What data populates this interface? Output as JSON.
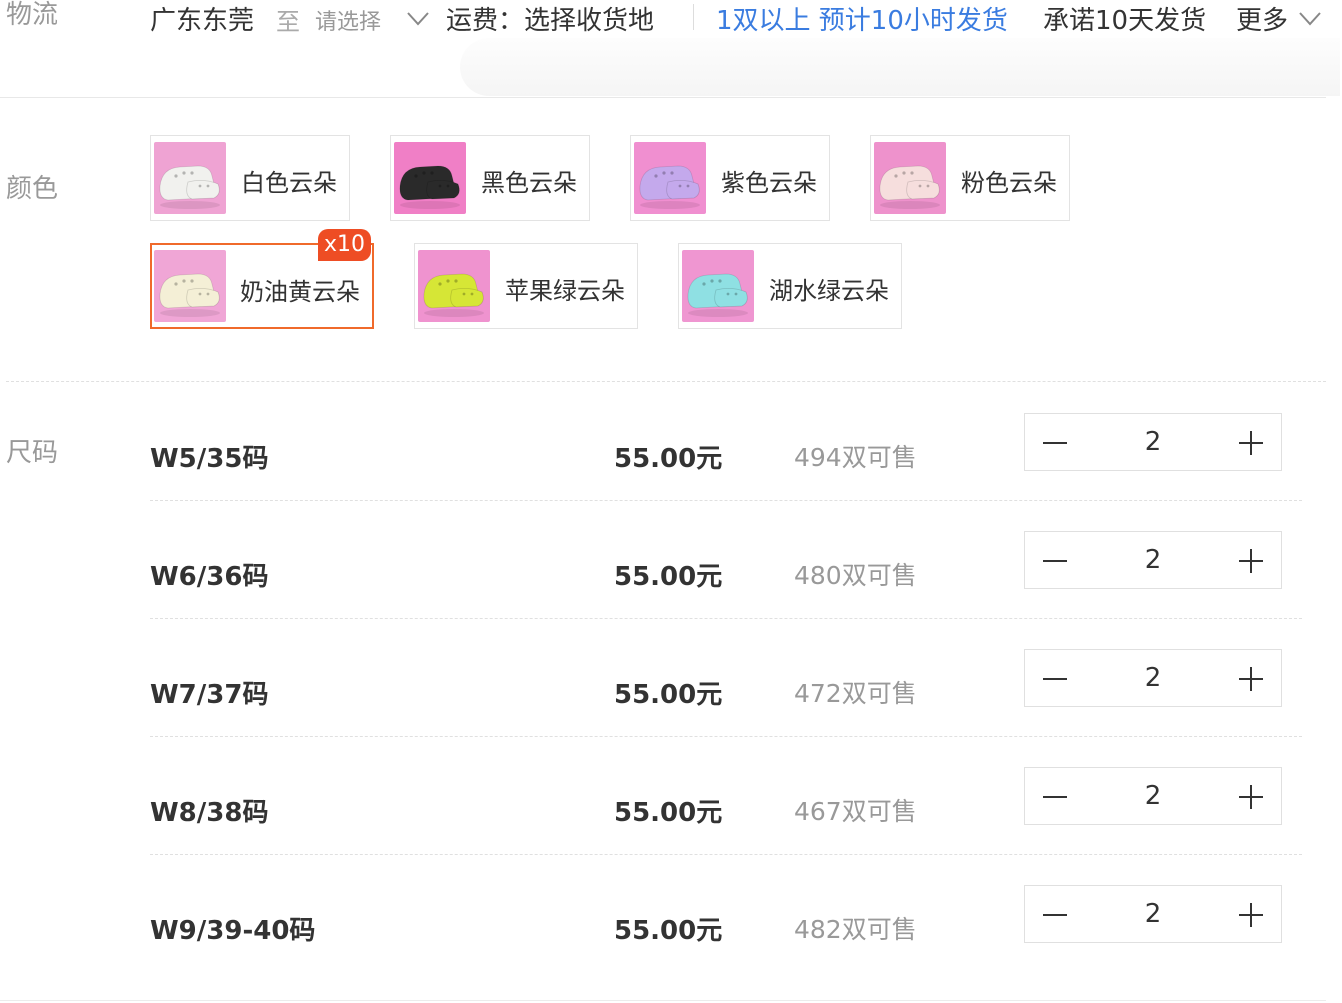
{
  "logistics": {
    "label": "物流",
    "from": "广东东莞",
    "to": "至",
    "select_placeholder": "请选择",
    "fee": "运费：选择收货地",
    "note": "1双以上 预计10小时发货",
    "promise": "承诺10天发货",
    "more": "更多"
  },
  "colors": {
    "label": "颜色",
    "items": [
      {
        "name": "白色云朵",
        "shoe_color": "#f1f1ee",
        "bg": "#efa3d3"
      },
      {
        "name": "黑色云朵",
        "shoe_color": "#2a2a2a",
        "bg": "#f07fc6"
      },
      {
        "name": "紫色云朵",
        "shoe_color": "#c4a9ec",
        "bg": "#f08fd0"
      },
      {
        "name": "粉色云朵",
        "shoe_color": "#f6dedd",
        "bg": "#ee92cc"
      },
      {
        "name": "奶油黄云朵",
        "shoe_color": "#f4efd6",
        "bg": "#f0a6d6",
        "selected": true,
        "badge": "x10"
      },
      {
        "name": "苹果绿云朵",
        "shoe_color": "#d6e636",
        "bg": "#ef93cf"
      },
      {
        "name": "湖水绿云朵",
        "shoe_color": "#8fe0e3",
        "bg": "#ef96d1"
      }
    ],
    "accent_color": "#f06a2b",
    "badge_color": "#ee4d24"
  },
  "sizes": {
    "label": "尺码",
    "rows": [
      {
        "size": "W5/35码",
        "price": "55.00元",
        "stock": "494双可售",
        "qty": "2"
      },
      {
        "size": "W6/36码",
        "price": "55.00元",
        "stock": "480双可售",
        "qty": "2"
      },
      {
        "size": "W7/37码",
        "price": "55.00元",
        "stock": "472双可售",
        "qty": "2"
      },
      {
        "size": "W8/38码",
        "price": "55.00元",
        "stock": "467双可售",
        "qty": "2"
      },
      {
        "size": "W9/39-40码",
        "price": "55.00元",
        "stock": "482双可售",
        "qty": "2"
      }
    ]
  },
  "link_color": "#3a7ce0"
}
